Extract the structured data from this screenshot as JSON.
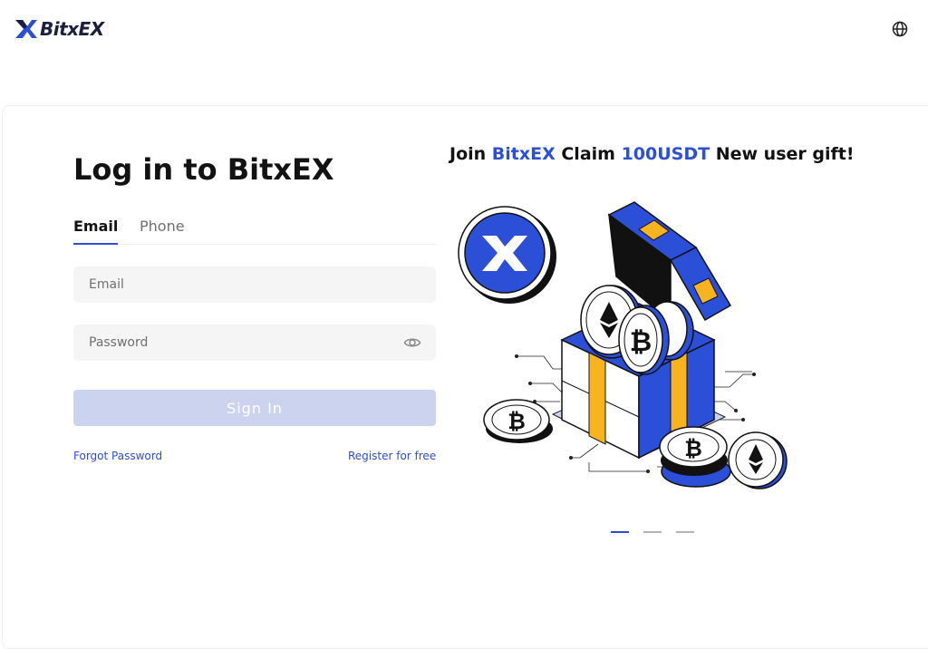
{
  "header": {
    "brand": "BitxEX",
    "language_icon": "globe-icon"
  },
  "login": {
    "title": "Log in to BitxEX",
    "tabs": [
      {
        "label": "Email",
        "active": true
      },
      {
        "label": "Phone",
        "active": false
      }
    ],
    "email_placeholder": "Email",
    "password_placeholder": "Password",
    "password_toggle_icon": "eye-icon",
    "submit_label": "Sign In",
    "forgot_label": "Forgot Password",
    "register_label": "Register for free"
  },
  "promo": {
    "part1": "Join ",
    "brand": "BitxEX",
    "part2": " Claim ",
    "amount": "100USDT",
    "part3": " New user gift!"
  },
  "carousel": {
    "slides": 3,
    "active_index": 0
  },
  "colors": {
    "accent": "#2b4fd6",
    "button_disabled": "#cbd3ee",
    "ribbon": "#f9b31f"
  }
}
